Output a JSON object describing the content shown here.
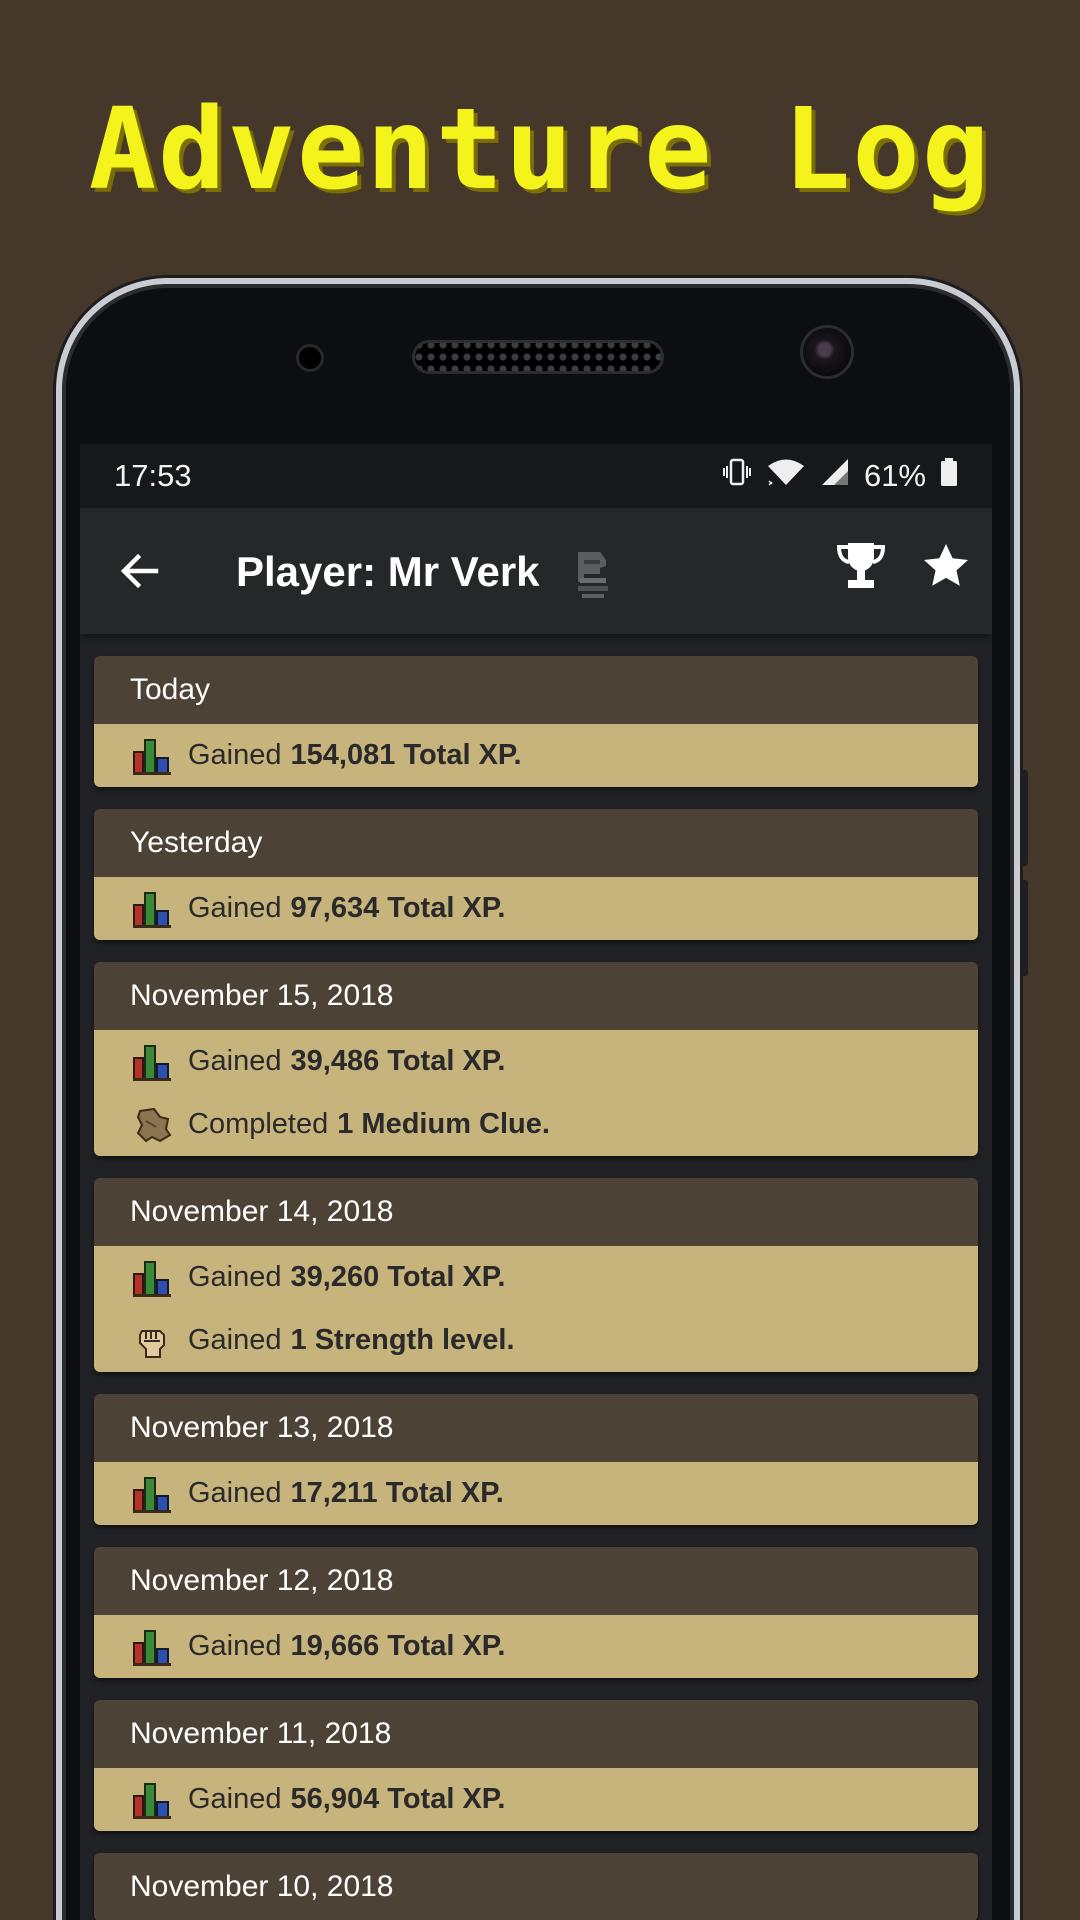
{
  "banner": {
    "title": "Adventure Log"
  },
  "status_bar": {
    "time": "17:53",
    "battery": "61%"
  },
  "app_bar": {
    "title": "Player: Mr Verk"
  },
  "cards": [
    {
      "date": "Today",
      "entries": [
        {
          "icon": "stats-icon",
          "prefix": "Gained",
          "value": "154,081 Total XP."
        }
      ]
    },
    {
      "date": "Yesterday",
      "entries": [
        {
          "icon": "stats-icon",
          "prefix": "Gained",
          "value": "97,634 Total XP."
        }
      ]
    },
    {
      "date": "November 15, 2018",
      "entries": [
        {
          "icon": "stats-icon",
          "prefix": "Gained",
          "value": "39,486 Total XP."
        },
        {
          "icon": "clue-scroll-icon",
          "prefix": "Completed",
          "value": "1 Medium Clue."
        }
      ]
    },
    {
      "date": "November 14, 2018",
      "entries": [
        {
          "icon": "stats-icon",
          "prefix": "Gained",
          "value": "39,260 Total XP."
        },
        {
          "icon": "strength-fist-icon",
          "prefix": "Gained",
          "value": "1 Strength level."
        }
      ]
    },
    {
      "date": "November 13, 2018",
      "entries": [
        {
          "icon": "stats-icon",
          "prefix": "Gained",
          "value": "17,211 Total XP."
        }
      ]
    },
    {
      "date": "November 12, 2018",
      "entries": [
        {
          "icon": "stats-icon",
          "prefix": "Gained",
          "value": "19,666 Total XP."
        }
      ]
    },
    {
      "date": "November 11, 2018",
      "entries": [
        {
          "icon": "stats-icon",
          "prefix": "Gained",
          "value": "56,904 Total XP."
        }
      ]
    },
    {
      "date": "November 10, 2018",
      "entries": []
    }
  ],
  "colors": {
    "background": "#45372a",
    "banner_text": "#f5f31c",
    "card_header": "#4d4236",
    "card_body": "#c7b37c",
    "appbar": "#26272b"
  }
}
